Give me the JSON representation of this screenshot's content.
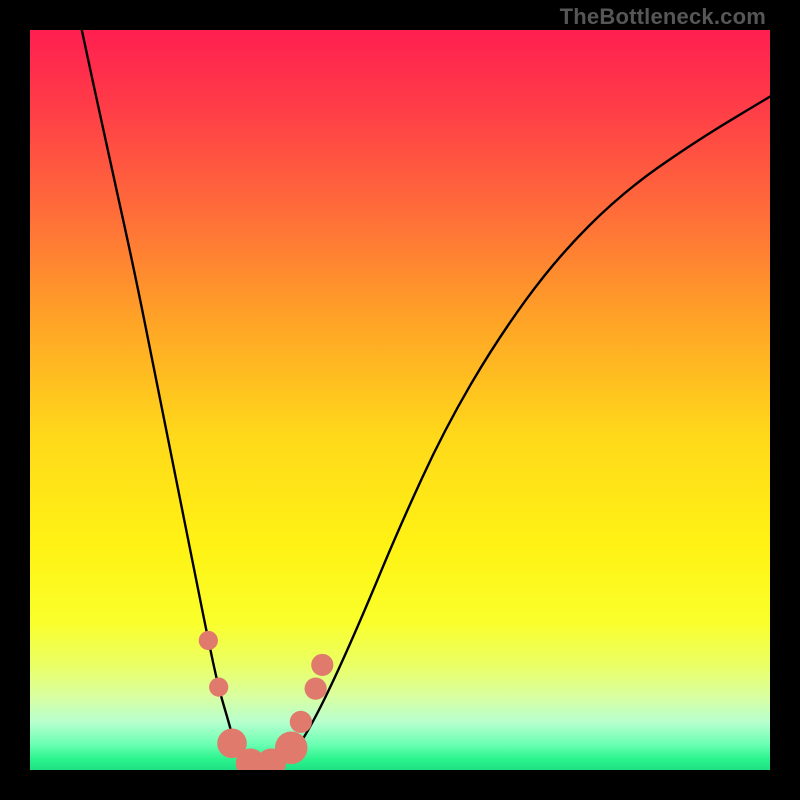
{
  "watermark": "TheBottleneck.com",
  "chart_data": {
    "type": "line",
    "title": "",
    "xlabel": "",
    "ylabel": "",
    "xlim": [
      0,
      100
    ],
    "ylim": [
      0,
      100
    ],
    "grid": false,
    "background_gradient_stops": [
      {
        "pos": 0.0,
        "color": "#ff1f50"
      },
      {
        "pos": 0.1,
        "color": "#ff3b48"
      },
      {
        "pos": 0.25,
        "color": "#ff6e39"
      },
      {
        "pos": 0.4,
        "color": "#ffa626"
      },
      {
        "pos": 0.55,
        "color": "#ffd91a"
      },
      {
        "pos": 0.7,
        "color": "#fff314"
      },
      {
        "pos": 0.8,
        "color": "#faff2b"
      },
      {
        "pos": 0.86,
        "color": "#eaff67"
      },
      {
        "pos": 0.9,
        "color": "#d9ffa0"
      },
      {
        "pos": 0.935,
        "color": "#b8ffcf"
      },
      {
        "pos": 0.965,
        "color": "#6cffb3"
      },
      {
        "pos": 0.985,
        "color": "#2cf48d"
      },
      {
        "pos": 1.0,
        "color": "#1ee084"
      }
    ],
    "series": [
      {
        "name": "bottleneck-curve",
        "x": [
          7,
          10,
          14,
          17,
          20,
          22,
          24,
          25.5,
          27,
          28,
          29.5,
          31,
          33,
          35.5,
          38,
          41,
          45,
          50,
          56,
          63,
          71,
          80,
          90,
          100
        ],
        "y": [
          100,
          86,
          68,
          53,
          38,
          28,
          18,
          11,
          6,
          2,
          0,
          0,
          0.5,
          2,
          6,
          12,
          21,
          33,
          46,
          58,
          69,
          78,
          85,
          91
        ]
      }
    ],
    "markers": [
      {
        "x": 24.1,
        "y": 17.5,
        "r": 1.3,
        "color": "#e07a6c"
      },
      {
        "x": 25.5,
        "y": 11.2,
        "r": 1.3,
        "color": "#e07a6c"
      },
      {
        "x": 27.3,
        "y": 3.6,
        "r": 2.0,
        "color": "#e07a6c"
      },
      {
        "x": 29.8,
        "y": 0.9,
        "r": 2.0,
        "color": "#e07a6c"
      },
      {
        "x": 32.6,
        "y": 0.9,
        "r": 2.0,
        "color": "#e07a6c"
      },
      {
        "x": 35.3,
        "y": 3.0,
        "r": 2.2,
        "color": "#e07a6c"
      },
      {
        "x": 36.6,
        "y": 6.5,
        "r": 1.5,
        "color": "#e07a6c"
      },
      {
        "x": 38.6,
        "y": 11.0,
        "r": 1.5,
        "color": "#e07a6c"
      },
      {
        "x": 39.5,
        "y": 14.2,
        "r": 1.5,
        "color": "#e07a6c"
      }
    ],
    "annotations": []
  }
}
